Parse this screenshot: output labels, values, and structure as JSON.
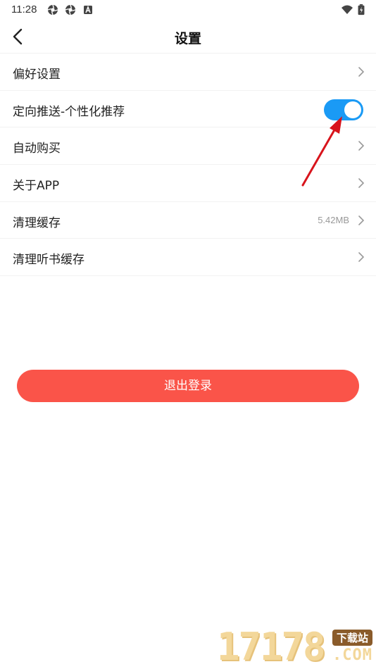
{
  "status_bar": {
    "time": "11:28"
  },
  "nav": {
    "title": "设置"
  },
  "settings": [
    {
      "label": "偏好设置",
      "type": "chevron"
    },
    {
      "label": "定向推送-个性化推荐",
      "type": "toggle",
      "on": true
    },
    {
      "label": "自动购买",
      "type": "chevron"
    },
    {
      "label": "关于APP",
      "type": "chevron"
    },
    {
      "label": "清理缓存",
      "type": "chevron",
      "value": "5.42MB"
    },
    {
      "label": "清理听书缓存",
      "type": "chevron"
    }
  ],
  "logout": {
    "label": "退出登录"
  },
  "watermark": {
    "number": "17178",
    "badge": "下载站",
    "domain": ".COM"
  },
  "colors": {
    "toggle_on": "#1a9af5",
    "logout_bg": "#fa5449",
    "annotation_arrow": "#d8141c"
  }
}
